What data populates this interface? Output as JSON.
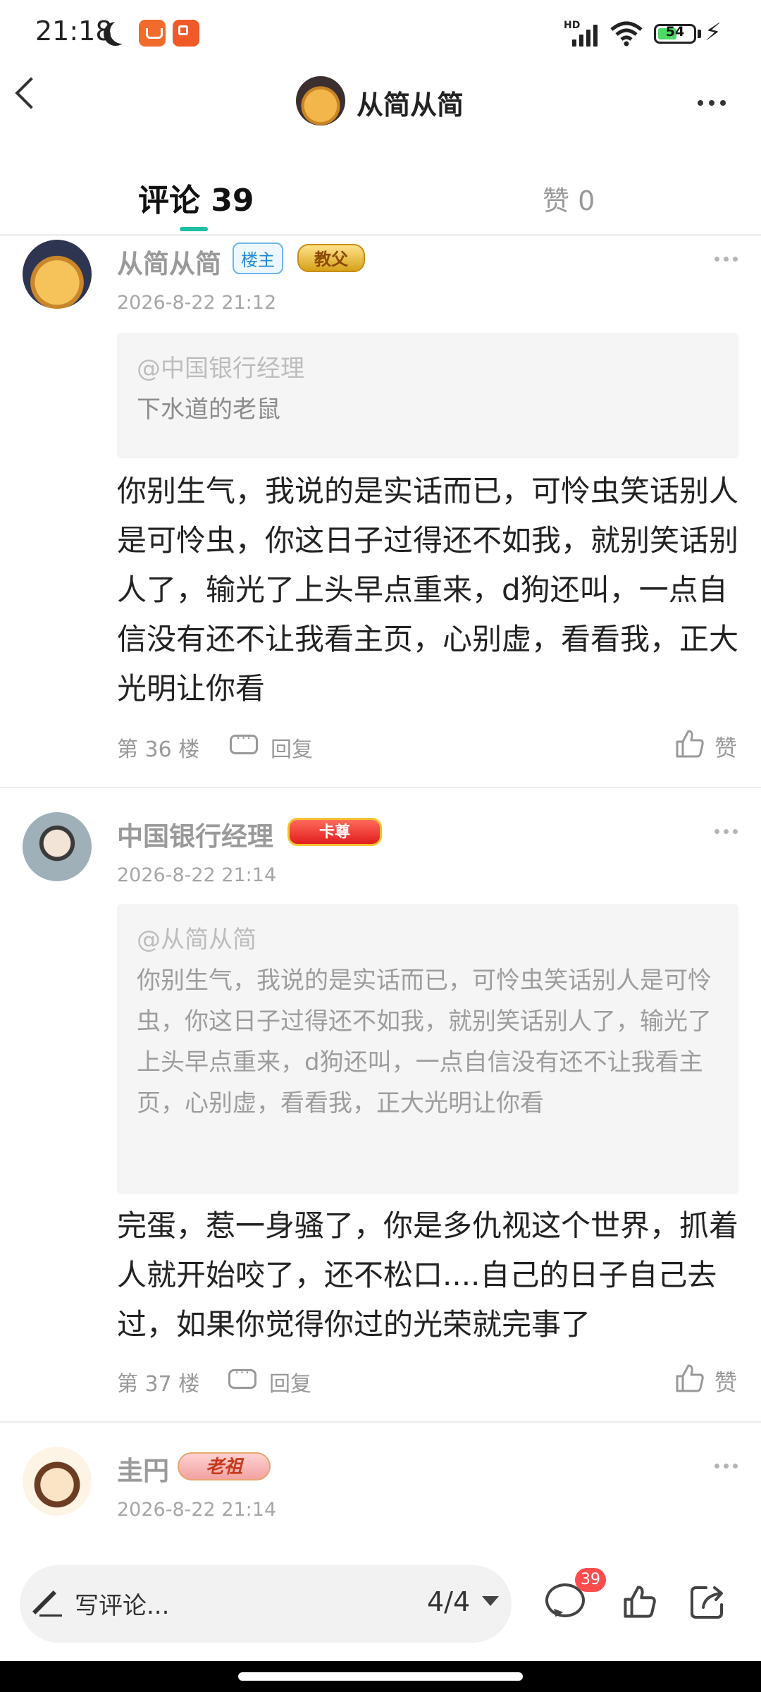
{
  "status_bar": {
    "time": "21:18",
    "network": "HD",
    "battery": "54"
  },
  "header": {
    "title": "从简从简"
  },
  "tabs": [
    {
      "label": "评论 39",
      "active": true
    },
    {
      "label": "赞 0",
      "active": false
    }
  ],
  "comments": [
    {
      "user": "从简从简",
      "badges": [
        "楼主",
        "教父"
      ],
      "date": "2026-8-22 21:12",
      "quote_user": "@中国银行经理",
      "quote_text": "下水道的老鼠",
      "body": "你别生气，我说的是实话而已，可怜虫笑话别人是可怜虫，你这日子过得还不如我，就别笑话别人了，输光了上头早点重来，d狗还叫，一点自信没有还不让我看主页，心别虚，看看我，正大光明让你看",
      "floor": "第 36 楼",
      "reply_label": "回复",
      "like_label": "赞"
    },
    {
      "user": "中国银行经理",
      "badges": [
        "卡尊"
      ],
      "date": "2026-8-22 21:14",
      "quote_user": "@从简从简",
      "quote_text": "你别生气，我说的是实话而已，可怜虫笑话别人是可怜虫，你这日子过得还不如我，就别笑话别人了，输光了上头早点重来，d狗还叫，一点自信没有还不让我看主页，心别虚，看看我，正大光明让你看",
      "body": "完蛋，惹一身骚了，你是多仇视这个世界，抓着人就开始咬了，还不松口....自己的日子自己去过，如果你觉得你过的光荣就完事了",
      "floor": "第 37 楼",
      "reply_label": "回复",
      "like_label": "赞"
    },
    {
      "user": "圭円",
      "badges": [
        "老祖"
      ],
      "date": "2026-8-22 21:14"
    }
  ],
  "bottom_bar": {
    "placeholder": "写评论...",
    "page": "4/4",
    "comment_count": "39"
  },
  "colors": {
    "accent": "#1dbfa5",
    "badge_red": "#ff4d4f",
    "host_badge": "#1f8ad9"
  },
  "icons": [
    "back-icon",
    "more-icon",
    "reply-icon",
    "like-icon",
    "pencil-icon",
    "comment-icon",
    "share-icon"
  ]
}
